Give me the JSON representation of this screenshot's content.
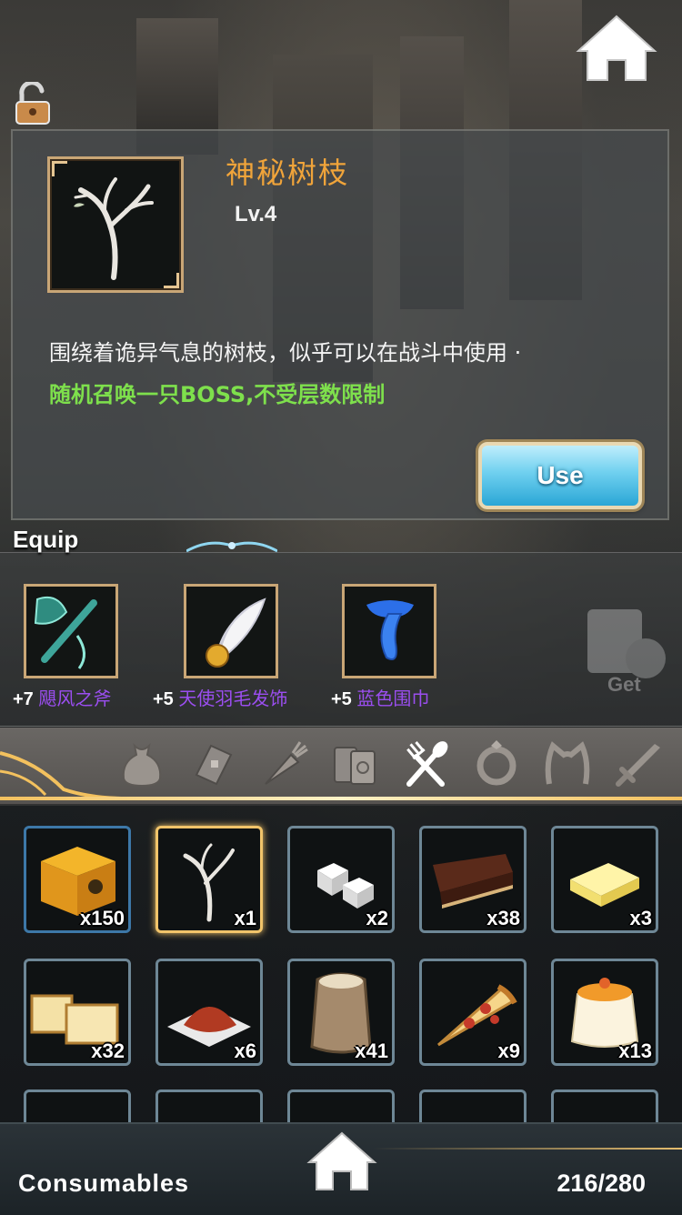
{
  "selected_item": {
    "name": "神秘树枝",
    "level": "Lv.4",
    "description": "围绕着诡异气息的树枝，似乎可以在战斗中使用 ·",
    "effect": "随机召唤一只BOSS,不受层数限制",
    "use_label": "Use",
    "icon": "branch-icon"
  },
  "equip": {
    "label": "Equip",
    "slots": [
      {
        "bonus": "+7",
        "name": "飓风之斧",
        "icon": "axe-icon"
      },
      {
        "bonus": "+5",
        "name": "天使羽毛发饰",
        "icon": "feather-hairpin-icon"
      },
      {
        "bonus": "+5",
        "name": "蓝色围巾",
        "icon": "scarf-icon"
      }
    ],
    "get_label": "Get"
  },
  "categories": [
    {
      "icon": "bag-icon",
      "active": false
    },
    {
      "icon": "scroll-icon",
      "active": false
    },
    {
      "icon": "carrot-icon",
      "active": false
    },
    {
      "icon": "books-icon",
      "active": false
    },
    {
      "icon": "fork-spoon-icon",
      "active": true
    },
    {
      "icon": "ring-icon",
      "active": false
    },
    {
      "icon": "cat-ears-icon",
      "active": false
    },
    {
      "icon": "sword-icon",
      "active": false
    }
  ],
  "inventory": [
    {
      "icon": "treasure-box-icon",
      "count": "x150",
      "selected": false
    },
    {
      "icon": "branch-icon",
      "count": "x1",
      "selected": true
    },
    {
      "icon": "sugar-cubes-icon",
      "count": "x2",
      "selected": false
    },
    {
      "icon": "chocolate-cake-icon",
      "count": "x38",
      "selected": false
    },
    {
      "icon": "butter-icon",
      "count": "x3",
      "selected": false
    },
    {
      "icon": "sponge-cake-icon",
      "count": "x32",
      "selected": false
    },
    {
      "icon": "chili-powder-icon",
      "count": "x6",
      "selected": false
    },
    {
      "icon": "flour-sack-icon",
      "count": "x41",
      "selected": false
    },
    {
      "icon": "pizza-slice-icon",
      "count": "x9",
      "selected": false
    },
    {
      "icon": "pudding-icon",
      "count": "x13",
      "selected": false
    }
  ],
  "footer": {
    "category_title": "Consumables",
    "capacity": "216/280"
  }
}
